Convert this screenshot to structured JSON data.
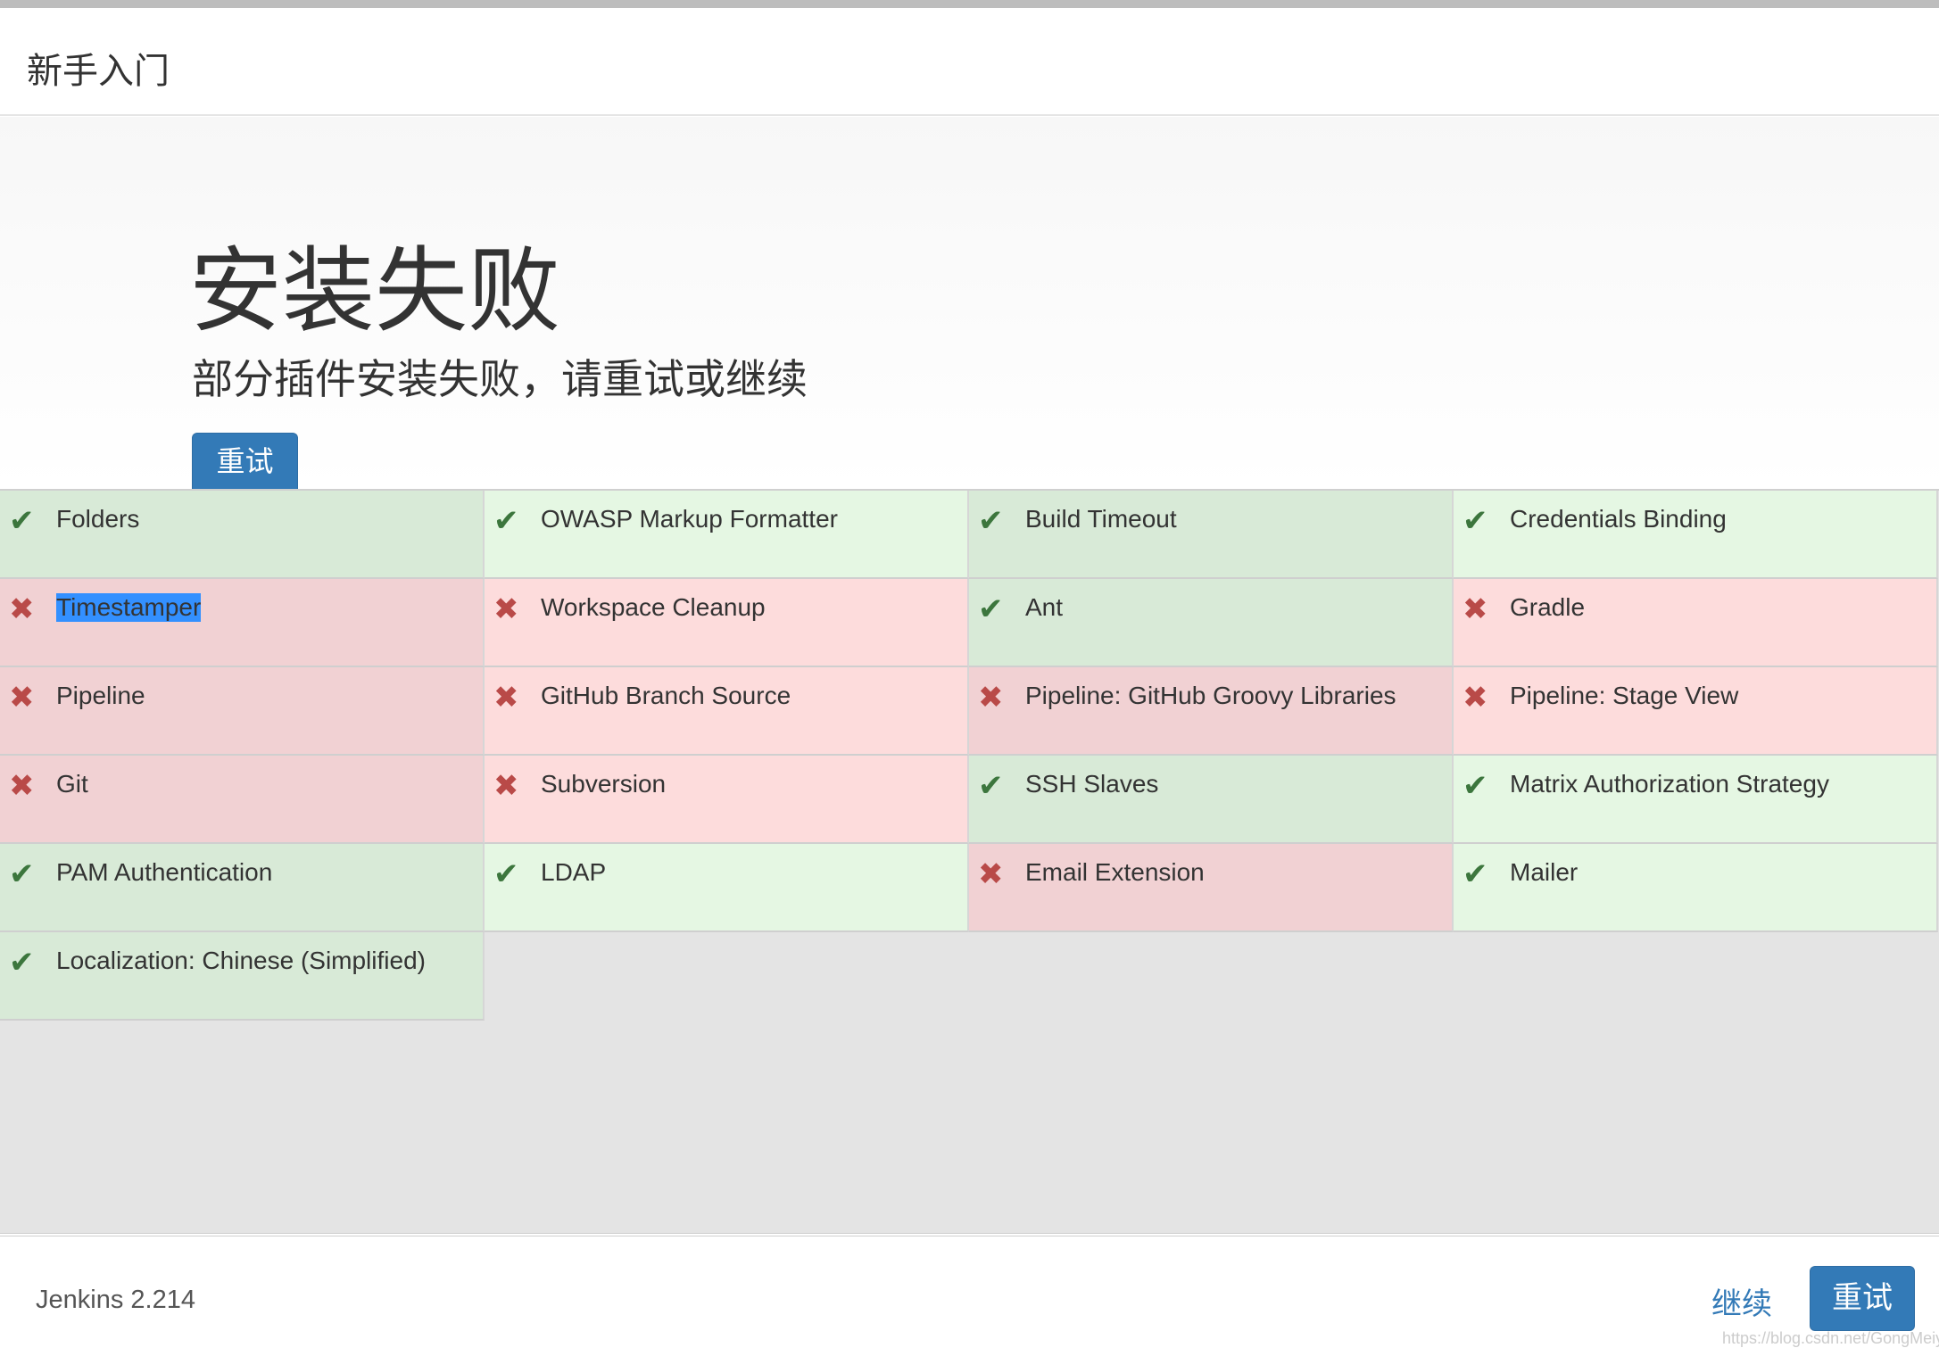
{
  "header": {
    "title": "新手入门"
  },
  "hero": {
    "title": "安装失败",
    "subtitle": "部分插件安装失败，请重试或继续",
    "retry_label": "重试"
  },
  "plugins": [
    {
      "name": "Folders",
      "status": "success"
    },
    {
      "name": "OWASP Markup Formatter",
      "status": "success"
    },
    {
      "name": "Build Timeout",
      "status": "success"
    },
    {
      "name": "Credentials Binding",
      "status": "success"
    },
    {
      "name": "Timestamper",
      "status": "failed"
    },
    {
      "name": "Workspace Cleanup",
      "status": "failed"
    },
    {
      "name": "Ant",
      "status": "success"
    },
    {
      "name": "Gradle",
      "status": "failed"
    },
    {
      "name": "Pipeline",
      "status": "failed"
    },
    {
      "name": "GitHub Branch Source",
      "status": "failed"
    },
    {
      "name": "Pipeline: GitHub Groovy Libraries",
      "status": "failed"
    },
    {
      "name": "Pipeline: Stage View",
      "status": "failed"
    },
    {
      "name": "Git",
      "status": "failed"
    },
    {
      "name": "Subversion",
      "status": "failed"
    },
    {
      "name": "SSH Slaves",
      "status": "success"
    },
    {
      "name": "Matrix Authorization Strategy",
      "status": "success"
    },
    {
      "name": "PAM Authentication",
      "status": "success"
    },
    {
      "name": "LDAP",
      "status": "success"
    },
    {
      "name": "Email Extension",
      "status": "failed"
    },
    {
      "name": "Mailer",
      "status": "success"
    },
    {
      "name": "Localization: Chinese (Simplified)",
      "status": "success"
    }
  ],
  "icons": {
    "success": "check-icon",
    "failed": "x-icon"
  },
  "colors": {
    "accent": "#337ab7",
    "success": "#3c763d",
    "failed": "#b94a48"
  },
  "footer": {
    "version": "Jenkins 2.214",
    "continue_label": "继续",
    "retry_label": "重试",
    "watermark": "https://blog.csdn.net/GongMeiyan"
  }
}
